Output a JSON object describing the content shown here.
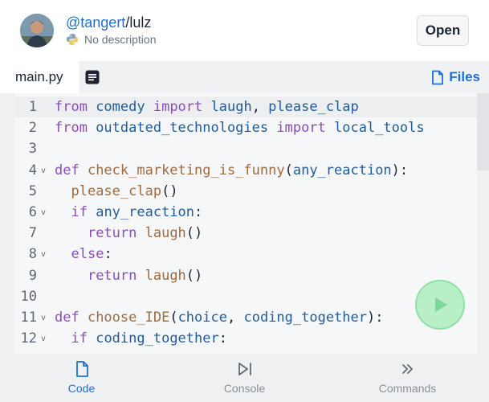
{
  "header": {
    "owner": "@tangert",
    "separator": "/",
    "repl_name": "lulz",
    "description": "No description",
    "language_icon": "python-icon",
    "open_label": "Open"
  },
  "tabs": {
    "active_file": "main.py",
    "list_icon": "list-icon",
    "files_label": "Files",
    "files_icon": "file-icon"
  },
  "editor": {
    "lines": [
      {
        "num": "1",
        "fold": "",
        "tokens": [
          [
            "kw",
            "from "
          ],
          [
            "var",
            "comedy "
          ],
          [
            "kw",
            "import "
          ],
          [
            "var",
            "laugh"
          ],
          [
            "plain",
            ", "
          ],
          [
            "var",
            "please_clap"
          ]
        ]
      },
      {
        "num": "2",
        "fold": "",
        "tokens": [
          [
            "kw",
            "from "
          ],
          [
            "var",
            "outdated_technologies "
          ],
          [
            "kw",
            "import "
          ],
          [
            "var",
            "local_tools"
          ]
        ]
      },
      {
        "num": "3",
        "fold": "",
        "tokens": []
      },
      {
        "num": "4",
        "fold": "v",
        "tokens": [
          [
            "kw",
            "def "
          ],
          [
            "fn",
            "check_marketing_is_funny"
          ],
          [
            "plain",
            "("
          ],
          [
            "var",
            "any_reaction"
          ],
          [
            "plain",
            "):"
          ]
        ]
      },
      {
        "num": "5",
        "fold": "",
        "tokens": [
          [
            "plain",
            "  "
          ],
          [
            "fn",
            "please_clap"
          ],
          [
            "plain",
            "()"
          ]
        ]
      },
      {
        "num": "6",
        "fold": "v",
        "tokens": [
          [
            "plain",
            "  "
          ],
          [
            "kw",
            "if "
          ],
          [
            "var",
            "any_reaction"
          ],
          [
            "plain",
            ":"
          ]
        ]
      },
      {
        "num": "7",
        "fold": "",
        "tokens": [
          [
            "plain",
            "    "
          ],
          [
            "kw",
            "return "
          ],
          [
            "fn",
            "laugh"
          ],
          [
            "plain",
            "()"
          ]
        ]
      },
      {
        "num": "8",
        "fold": "v",
        "tokens": [
          [
            "plain",
            "  "
          ],
          [
            "kw",
            "else"
          ],
          [
            "plain",
            ":"
          ]
        ]
      },
      {
        "num": "9",
        "fold": "",
        "tokens": [
          [
            "plain",
            "    "
          ],
          [
            "kw",
            "return "
          ],
          [
            "fn",
            "laugh"
          ],
          [
            "plain",
            "()"
          ]
        ]
      },
      {
        "num": "10",
        "fold": "",
        "tokens": []
      },
      {
        "num": "11",
        "fold": "v",
        "tokens": [
          [
            "kw",
            "def "
          ],
          [
            "fn",
            "choose_IDE"
          ],
          [
            "plain",
            "("
          ],
          [
            "var",
            "choice"
          ],
          [
            "plain",
            ", "
          ],
          [
            "var",
            "coding_together"
          ],
          [
            "plain",
            "):"
          ]
        ]
      },
      {
        "num": "12",
        "fold": "v",
        "tokens": [
          [
            "plain",
            "  "
          ],
          [
            "kw",
            "if "
          ],
          [
            "var",
            "coding_together"
          ],
          [
            "plain",
            ":"
          ]
        ]
      }
    ],
    "active_line": 1,
    "run_icon": "play-icon"
  },
  "bottom_nav": [
    {
      "label": "Code",
      "icon": "code-file-icon",
      "active": true
    },
    {
      "label": "Console",
      "icon": "console-icon",
      "active": false
    },
    {
      "label": "Commands",
      "icon": "commands-icon",
      "active": false
    }
  ],
  "colors": {
    "accent": "#1f6fd1",
    "keyword": "#8a4dbf",
    "function": "#a06a3d",
    "variable": "#1f5c9e",
    "run_button": "#b9efc7"
  }
}
